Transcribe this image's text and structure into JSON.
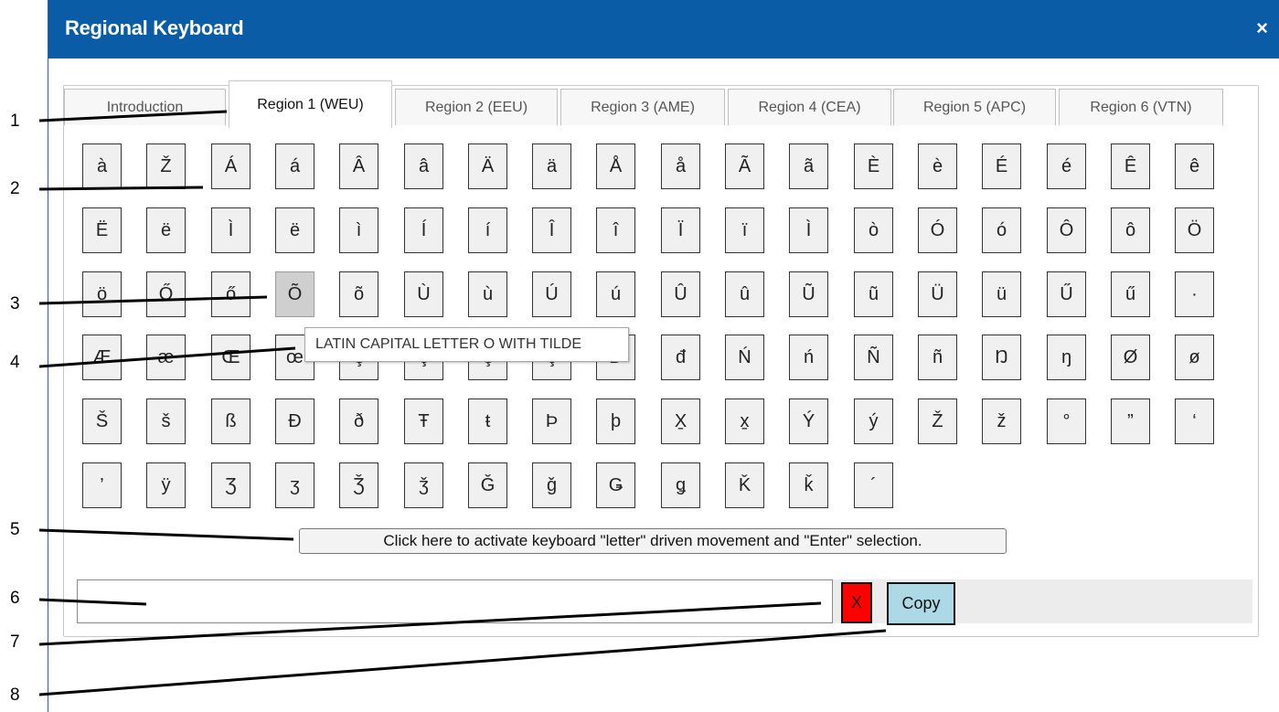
{
  "dialog": {
    "title": "Regional Keyboard",
    "close_symbol": "×"
  },
  "tabs": [
    {
      "label": "Introduction"
    },
    {
      "label": "Region 1 (WEU)"
    },
    {
      "label": "Region 2 (EEU)"
    },
    {
      "label": "Region 3 (AME)"
    },
    {
      "label": "Region 4 (CEA)"
    },
    {
      "label": "Region 5 (APC)"
    },
    {
      "label": "Region 6 (VTN)"
    }
  ],
  "keys": [
    [
      "à",
      "Ž",
      "Á",
      "á",
      "Â",
      "â",
      "Ä",
      "ä",
      "Å",
      "å",
      "Ã",
      "ã",
      "È",
      "è",
      "É",
      "é",
      "Ê",
      "ê"
    ],
    [
      "Ë",
      "ë",
      "Ì",
      "ë",
      "ì",
      "Í",
      "í",
      "Î",
      "î",
      "Ï",
      "ï",
      "Ì",
      "ò",
      "Ó",
      "ó",
      "Ô",
      "ô",
      "Ö"
    ],
    [
      "ö",
      "Ő",
      "ő",
      "Õ",
      "õ",
      "Ù",
      "ù",
      "Ú",
      "ú",
      "Û",
      "û",
      "Ũ",
      "ũ",
      "Ü",
      "ü",
      "Ű",
      "ű",
      "·"
    ],
    [
      "Æ",
      "æ",
      "Œ",
      "œ",
      "Ç",
      "ç",
      "Ç",
      "ç",
      "Ð",
      "đ",
      "Ń",
      "ń",
      "Ñ",
      "ñ",
      "Ŋ",
      "ŋ",
      "Ø",
      "ø"
    ],
    [
      "Š",
      "š",
      "ß",
      "Ð",
      "ð",
      "Ŧ",
      "ŧ",
      "Þ",
      "þ",
      "X̱",
      "x̱",
      "Ý",
      "ý",
      "Ž",
      "ž",
      "°",
      "”",
      "‘"
    ],
    [
      "’",
      "ÿ",
      "Ʒ",
      "ʒ",
      "Ǯ",
      "ǯ",
      "Ǧ",
      "ǧ",
      "Ǥ",
      "ǥ",
      "Ǩ",
      "ǩ",
      "´"
    ]
  ],
  "tooltip": "LATIN CAPITAL LETTER O WITH TILDE",
  "activate_label": "Click here to activate keyboard \"letter\" driven movement and \"Enter\" selection.",
  "output": {
    "value": ""
  },
  "clear_label": "X",
  "copy_label": "Copy",
  "callouts": [
    "1",
    "2",
    "3",
    "4",
    "5",
    "6",
    "7",
    "8"
  ],
  "colors": {
    "titlebar": "#0a5ca6",
    "clear_button": "#ff0000",
    "copy_button": "#add8e6",
    "hover_key": "#cfcfcf"
  }
}
